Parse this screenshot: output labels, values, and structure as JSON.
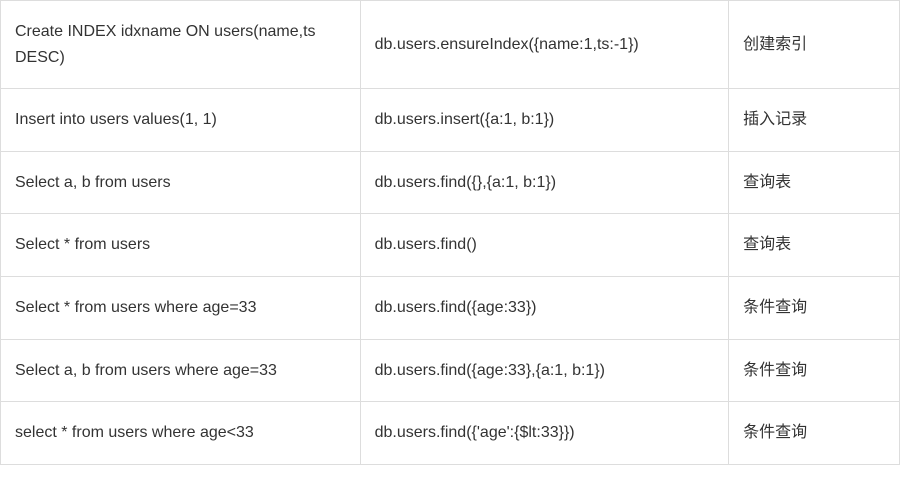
{
  "rows": [
    {
      "sql": "Create INDEX idxname ON users(name,ts DESC)",
      "mongo": "db.users.ensureIndex({name:1,ts:-1})",
      "desc": "创建索引"
    },
    {
      "sql": "Insert into users values(1, 1)",
      "mongo": "db.users.insert({a:1, b:1})",
      "desc": "插入记录"
    },
    {
      "sql": "Select a, b from users",
      "mongo": "db.users.find({},{a:1, b:1})",
      "desc": "查询表"
    },
    {
      "sql": "Select * from users",
      "mongo": "db.users.find()",
      "desc": "查询表"
    },
    {
      "sql": "Select * from users where age=33",
      "mongo": "db.users.find({age:33})",
      "desc": "条件查询"
    },
    {
      "sql": "Select a, b from users where age=33",
      "mongo": "db.users.find({age:33},{a:1, b:1})",
      "desc": "条件查询"
    },
    {
      "sql": "select * from users where age<33",
      "mongo": "db.users.find({'age':{$lt:33}})",
      "desc": "条件查询"
    }
  ]
}
